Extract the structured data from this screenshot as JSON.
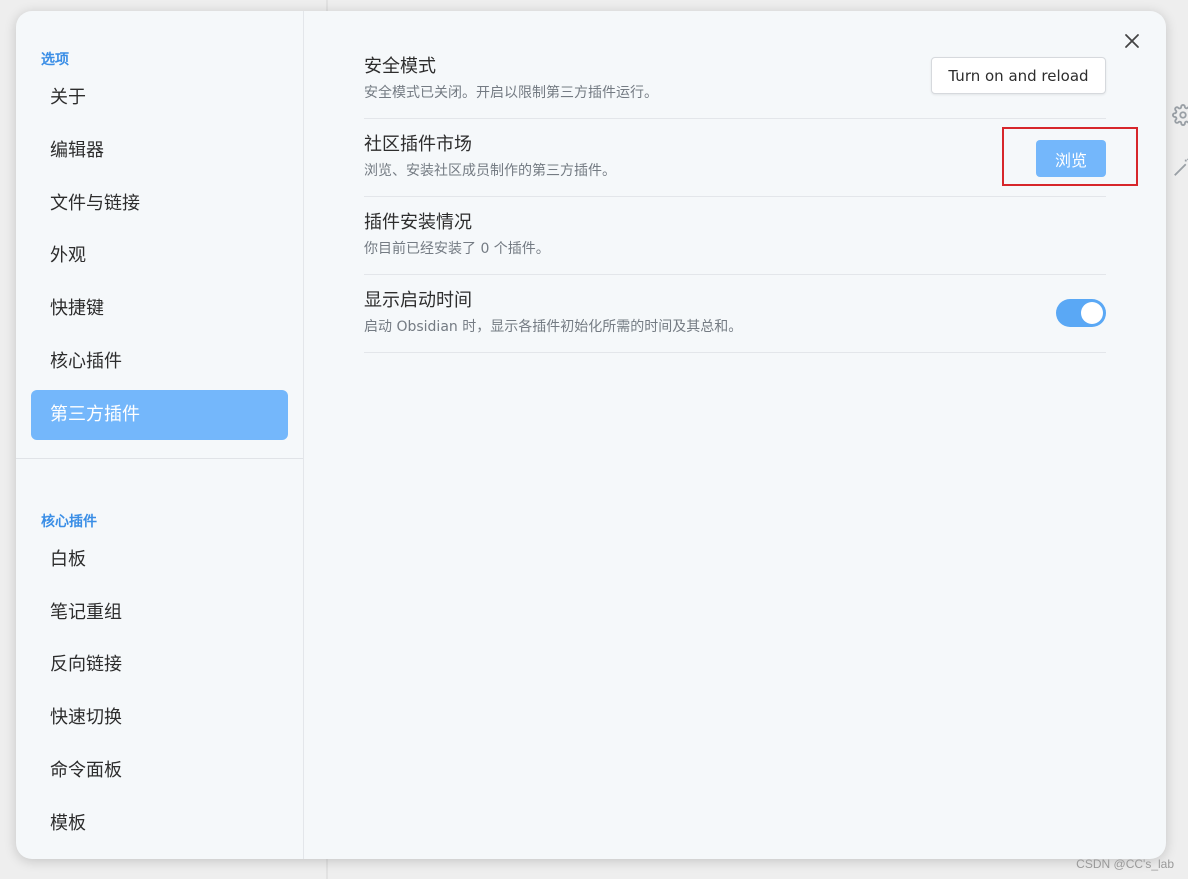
{
  "sidebar": {
    "options_title": "选项",
    "options_items": [
      {
        "label": "关于"
      },
      {
        "label": "编辑器"
      },
      {
        "label": "文件与链接"
      },
      {
        "label": "外观"
      },
      {
        "label": "快捷键"
      },
      {
        "label": "核心插件"
      },
      {
        "label": "第三方插件",
        "active": true
      }
    ],
    "core_title": "核心插件",
    "core_items": [
      {
        "label": "白板"
      },
      {
        "label": "笔记重组"
      },
      {
        "label": "反向链接"
      },
      {
        "label": "快速切换"
      },
      {
        "label": "命令面板"
      },
      {
        "label": "模板"
      }
    ]
  },
  "settings": [
    {
      "name": "安全模式",
      "desc": "安全模式已关闭。开启以限制第三方插件运行。",
      "button": "Turn on and reload"
    },
    {
      "name": "社区插件市场",
      "desc": "浏览、安装社区成员制作的第三方插件。",
      "button": "浏览"
    },
    {
      "name": "插件安装情况",
      "desc": "你目前已经安装了 0 个插件。"
    },
    {
      "name": "显示启动时间",
      "desc": "启动 Obsidian 时，显示各插件初始化所需的时间及其总和。",
      "toggle_on": true
    }
  ],
  "icons": {
    "close": "close-icon",
    "background": [
      "gear-icon",
      "wand-icon"
    ]
  },
  "colors": {
    "accent": "#74b7fb",
    "section_title": "#3a8ee6",
    "highlight_box": "#d7262b"
  },
  "watermark": "CSDN @CC's_lab"
}
